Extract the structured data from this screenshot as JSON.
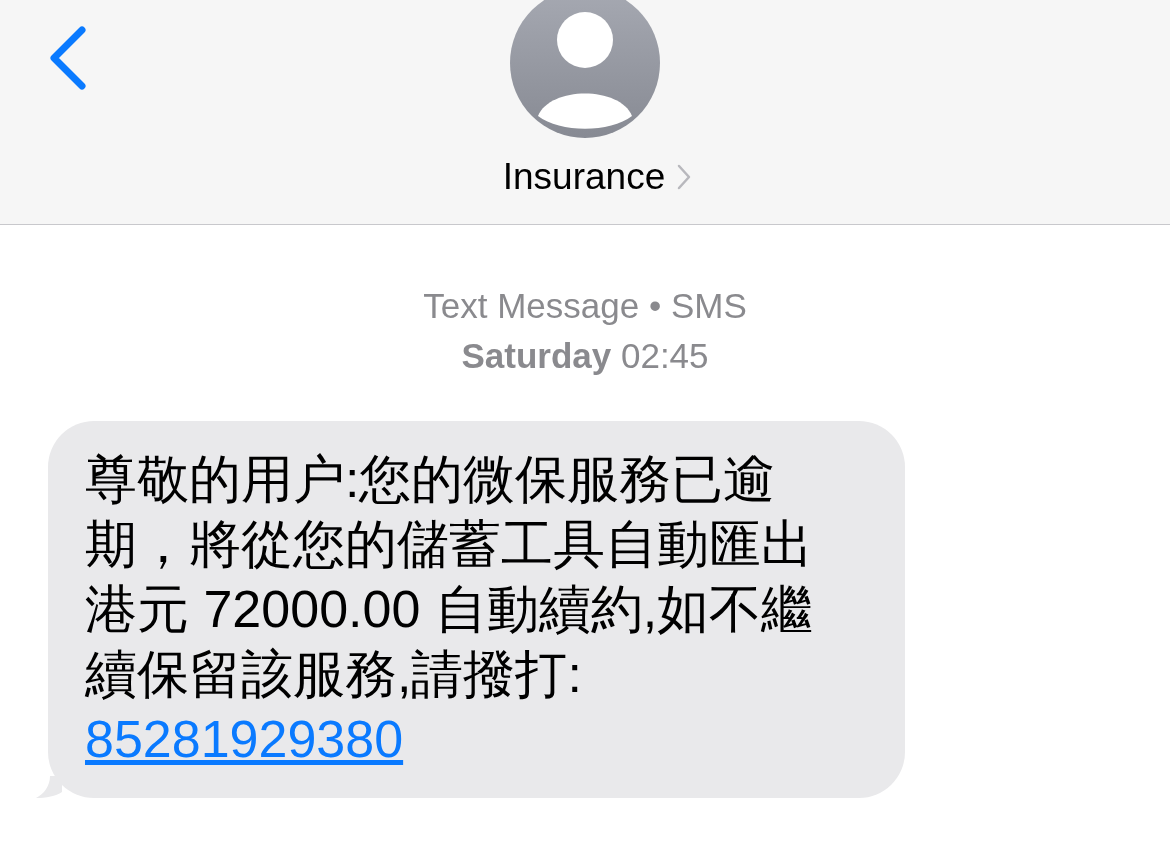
{
  "header": {
    "contact_name": "Insurance"
  },
  "conversation": {
    "service": "Text Message • SMS",
    "timestamp": "**Saturday** 02:45"
  },
  "messages": [
    {
      "kind": "incoming",
      "text": "尊敬的用户:您的微保服務已逾期，將從您的儲蓄工具自動匯出港元 72000.00 自動續約,如不繼續保留該服務,請撥打:",
      "link": "85281929380"
    }
  ]
}
